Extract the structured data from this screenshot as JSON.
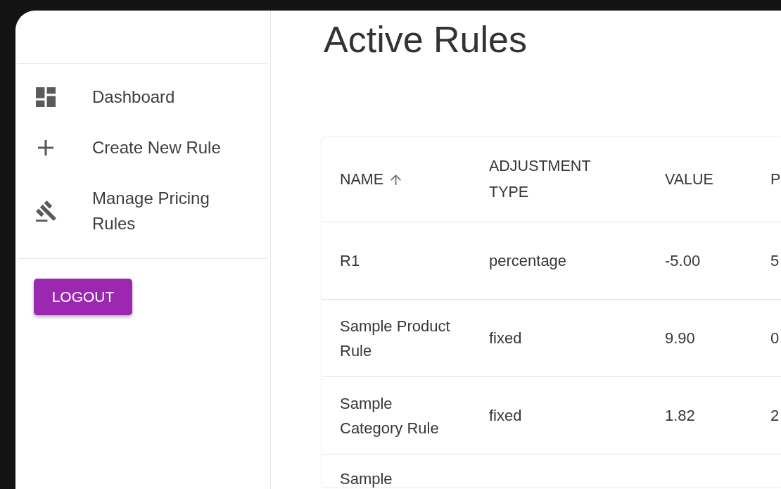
{
  "sidebar": {
    "items": [
      {
        "label": "Dashboard",
        "selected": false
      },
      {
        "label": "Create New Rule",
        "selected": false
      },
      {
        "label": "Manage Pricing Rules",
        "selected": false
      }
    ],
    "logout_button": {
      "label": "LOGOUT"
    }
  },
  "page_title": "Active Rules",
  "table": {
    "columns": [
      {
        "label": "NAME",
        "sorted": true
      },
      {
        "label": "ADJUSTMENT TYPE",
        "sorted": false
      },
      {
        "label": "VALUE",
        "sorted": false
      },
      {
        "label": "P",
        "sorted": false
      }
    ],
    "rows": [
      {
        "cells": [
          "R1",
          "percentage",
          "-5.00",
          "5"
        ]
      },
      {
        "cells": [
          "Sample Product Rule",
          "fixed",
          "9.90",
          "0"
        ]
      },
      {
        "cells": [
          "Sample Category Rule",
          "fixed",
          "1.82",
          "2"
        ]
      },
      {
        "cells": [
          "Sample"
        ]
      }
    ]
  }
}
